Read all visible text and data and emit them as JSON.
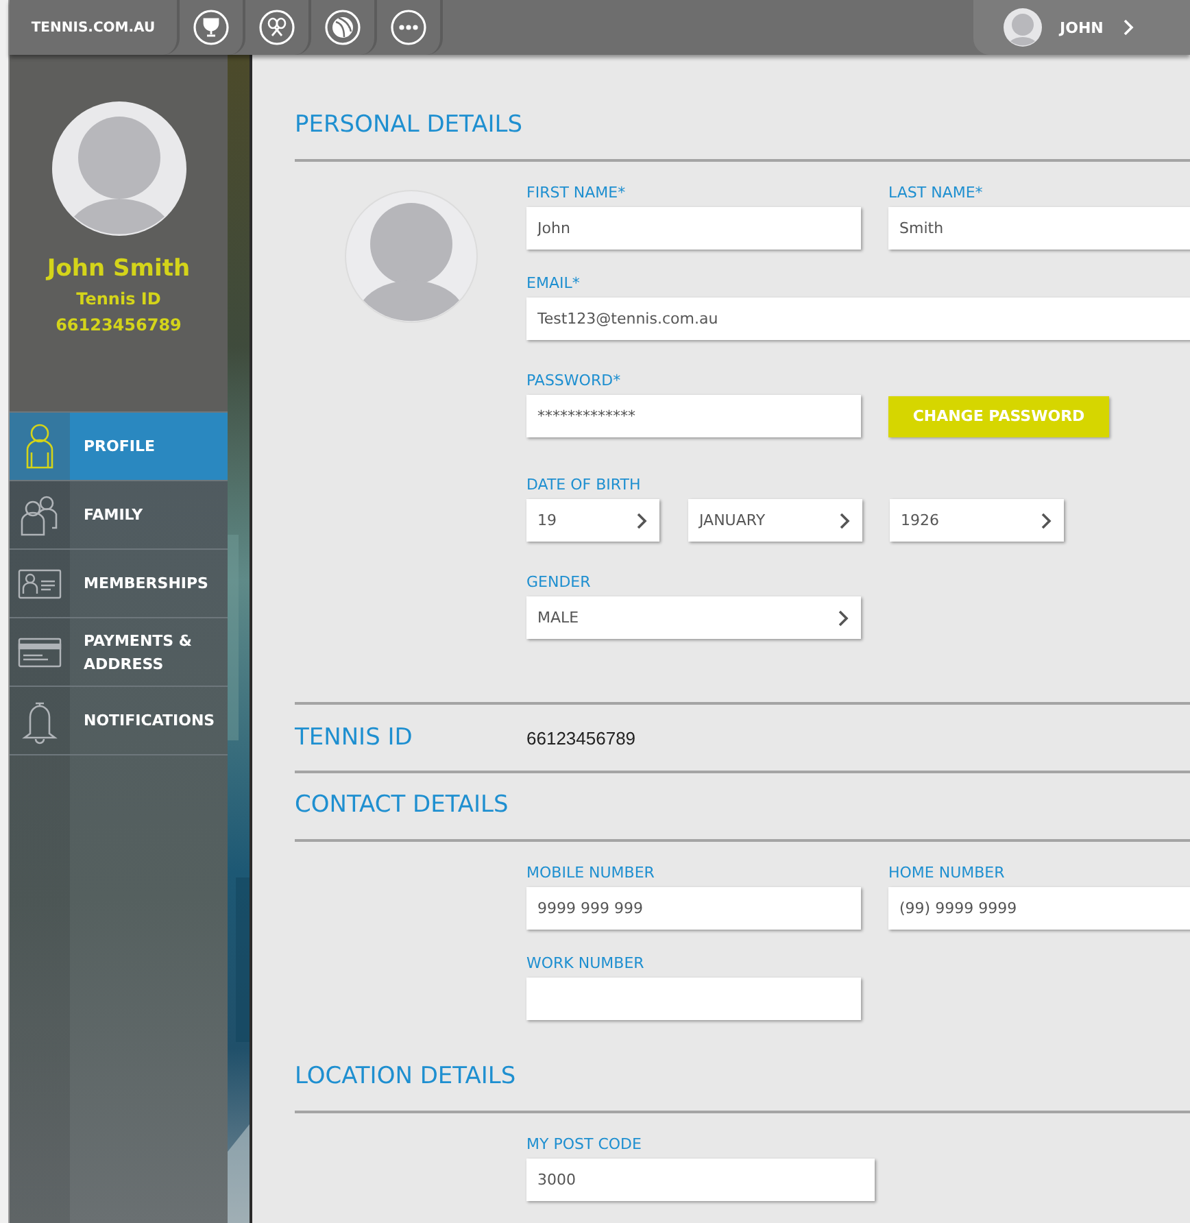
{
  "top_bar": {
    "site": "TENNIS.COM.AU",
    "user": "JOHN"
  },
  "sidebar": {
    "name": "John Smith",
    "id_label": "Tennis ID",
    "id_value": "66123456789",
    "menu": [
      {
        "kind": "profile",
        "label": "PROFILE",
        "selected": true
      },
      {
        "kind": "family",
        "label": "FAMILY",
        "selected": false
      },
      {
        "kind": "memberships",
        "label": "MEMBERSHIPS",
        "selected": false
      },
      {
        "kind": "payments",
        "label": "PAYMENTS & ADDRESS",
        "selected": false
      },
      {
        "kind": "notifications",
        "label": "NOTIFICATIONS",
        "selected": false
      }
    ]
  },
  "personal_details": {
    "title": "PERSONAL DETAILS",
    "first_name": {
      "label": "FIRST NAME*",
      "value": "John"
    },
    "last_name": {
      "label": "LAST NAME*",
      "value": "Smith"
    },
    "email": {
      "label": "EMAIL*",
      "value": "Test123@tennis.com.au"
    },
    "password": {
      "label": "PASSWORD*",
      "value": "*************"
    },
    "change_password_button": "CHANGE PASSWORD",
    "date_of_birth": {
      "label": "DATE OF BIRTH",
      "day": "19",
      "month": "JANUARY",
      "year": "1926"
    },
    "gender": {
      "label": "GENDER",
      "value": "MALE"
    }
  },
  "tennis_id": {
    "title": "TENNIS ID",
    "value": "66123456789"
  },
  "contact_details": {
    "title": "CONTACT DETAILS",
    "mobile": {
      "label": "MOBILE NUMBER",
      "value": "9999 999 999"
    },
    "home": {
      "label": "HOME NUMBER",
      "value": "(99) 9999 9999"
    },
    "work": {
      "label": "WORK NUMBER"
    }
  },
  "location_details": {
    "title": "LOCATION DETAILS",
    "post_code": {
      "label": "MY POST CODE",
      "value": "3000"
    }
  }
}
